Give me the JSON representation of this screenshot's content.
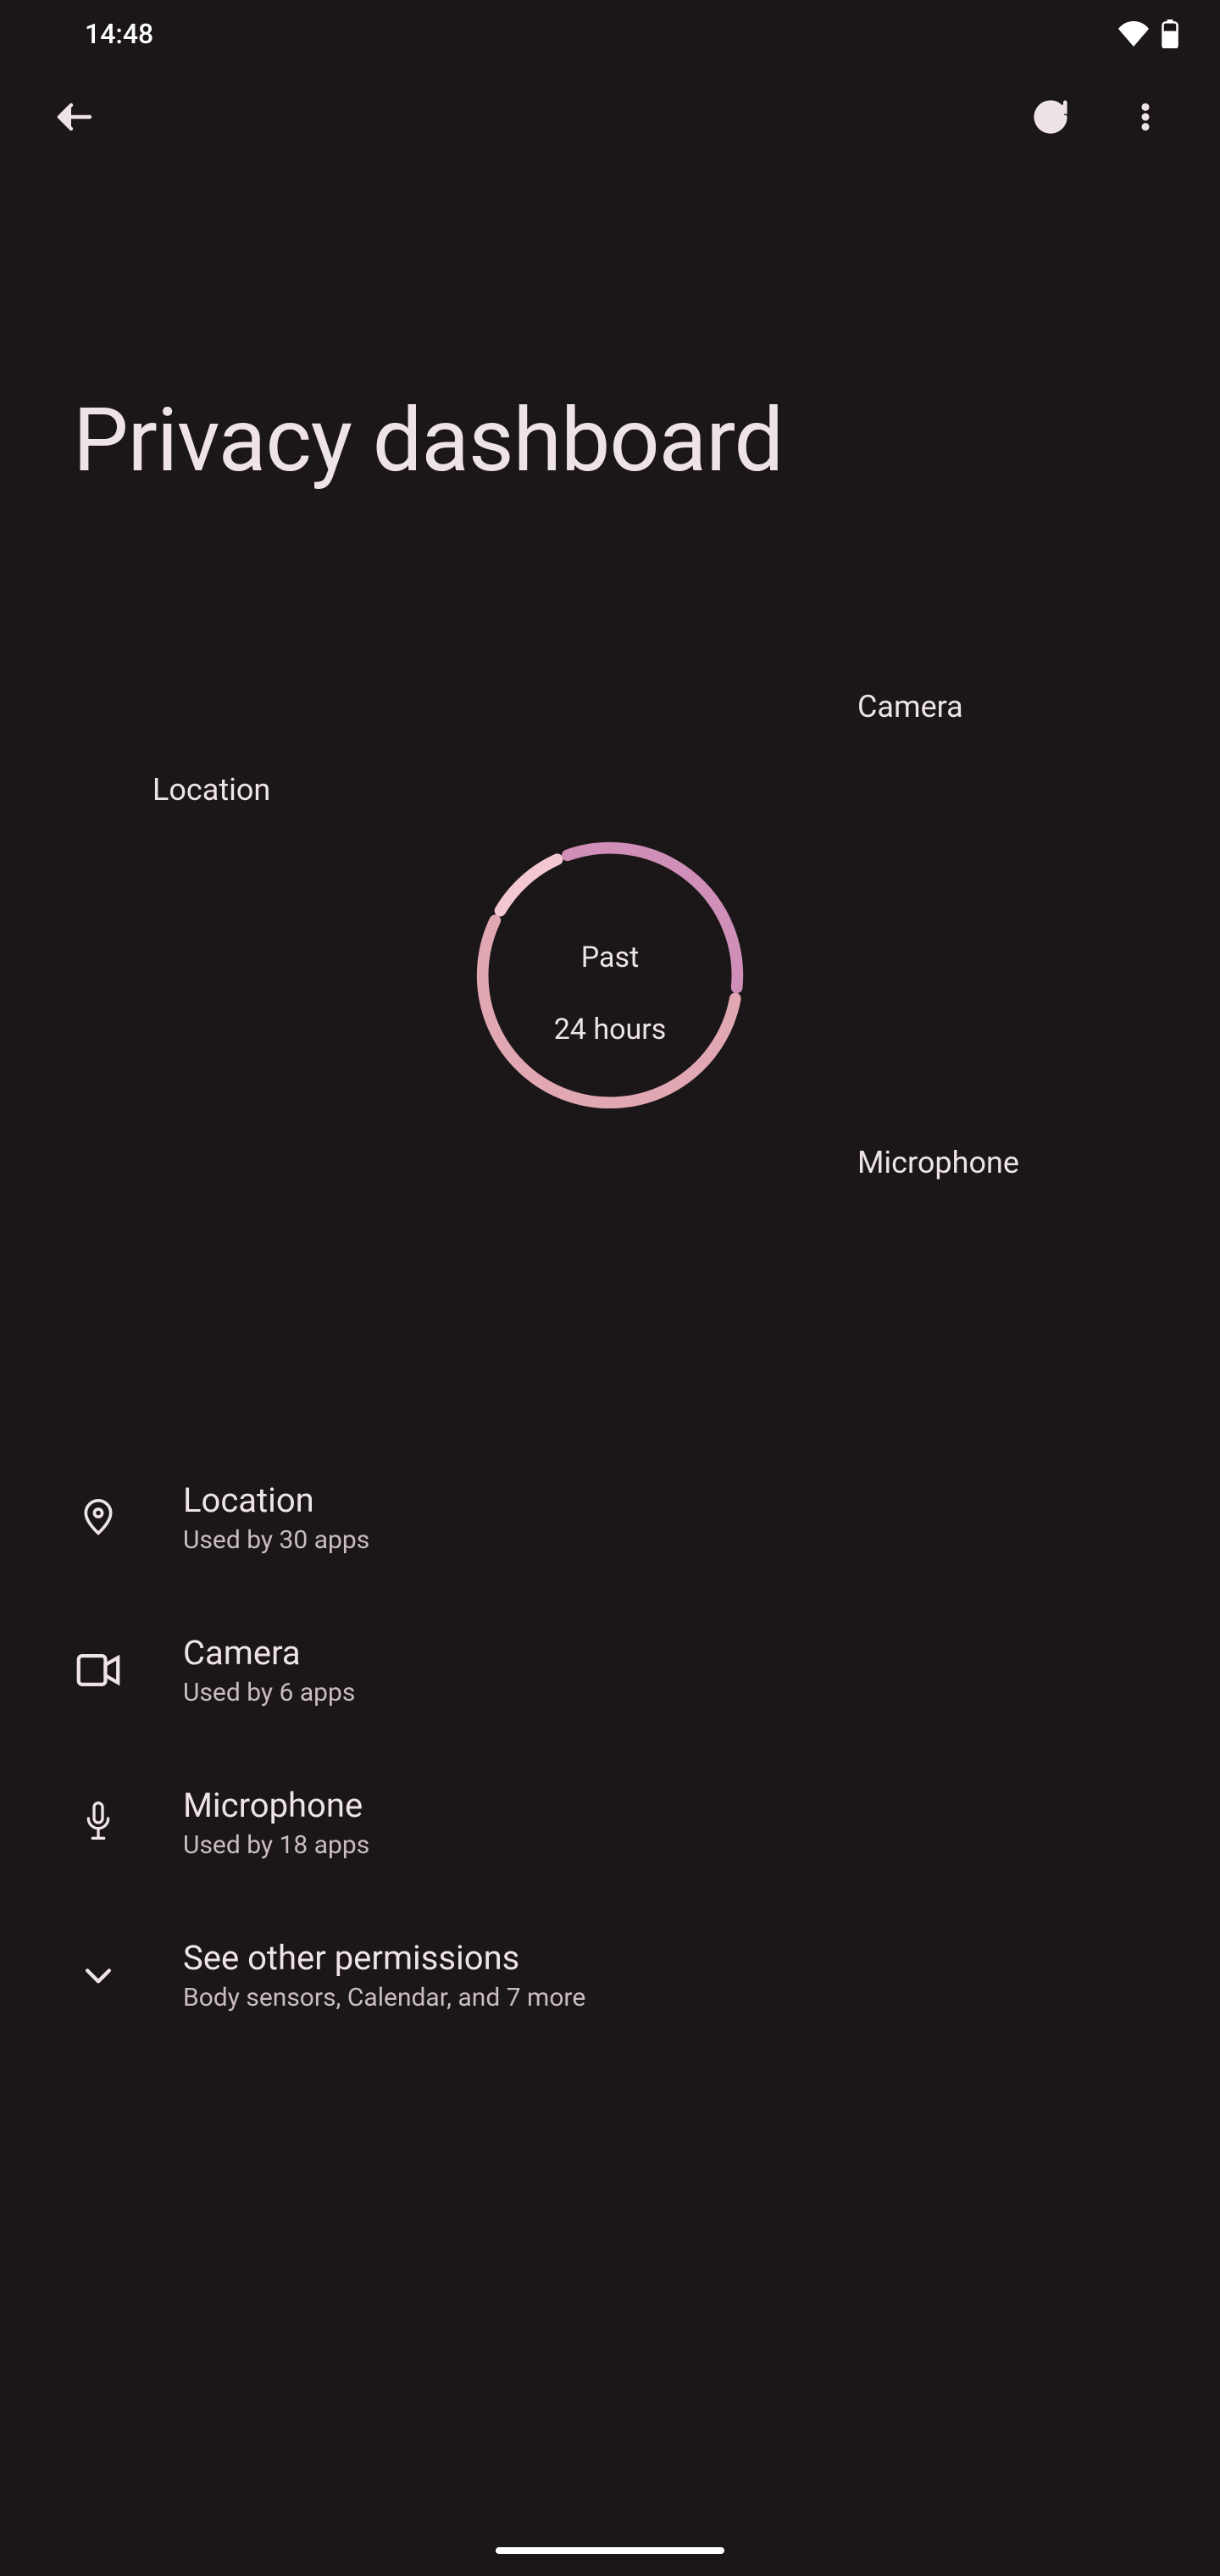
{
  "status": {
    "time": "14:48"
  },
  "page": {
    "title": "Privacy dashboard"
  },
  "chart_data": {
    "type": "pie",
    "title": "Past\n24 hours",
    "center_label_line1": "Past",
    "center_label_line2": "24 hours",
    "series": [
      {
        "name": "Location",
        "value": 30,
        "color": "#e1a7b2"
      },
      {
        "name": "Camera",
        "value": 6,
        "color": "#f3c8d1"
      },
      {
        "name": "Microphone",
        "value": 18,
        "color": "#cf8fb8"
      }
    ],
    "labels": {
      "location": "Location",
      "camera": "Camera",
      "microphone": "Microphone"
    }
  },
  "permissions": [
    {
      "title": "Location",
      "subtitle": "Used by 30 apps"
    },
    {
      "title": "Camera",
      "subtitle": "Used by 6 apps"
    },
    {
      "title": "Microphone",
      "subtitle": "Used by 18 apps"
    },
    {
      "title": "See other permissions",
      "subtitle": "Body sensors, Calendar, and 7 more"
    }
  ]
}
